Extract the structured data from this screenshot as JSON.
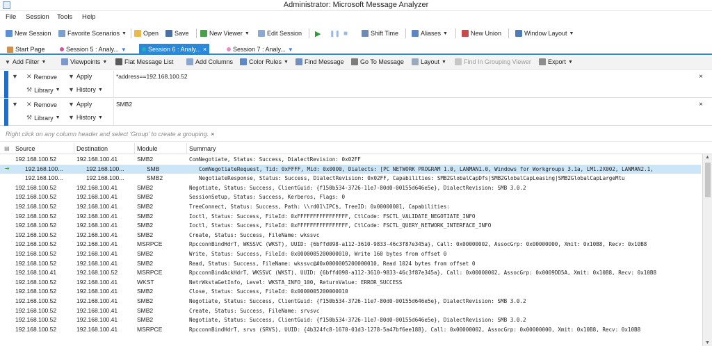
{
  "window": {
    "title": "Administrator: Microsoft Message Analyzer"
  },
  "menu": [
    "File",
    "Session",
    "Tools",
    "Help"
  ],
  "toolbar": {
    "new_session": "New Session",
    "favorite_scenarios": "Favorite Scenarios",
    "open": "Open",
    "save": "Save",
    "new_viewer": "New Viewer",
    "edit_session": "Edit Session",
    "shift_time": "Shift Time",
    "aliases": "Aliases",
    "new_union": "New Union",
    "window_layout": "Window Layout"
  },
  "tabs": [
    {
      "label": "Start Page"
    },
    {
      "label": "Session 5 : Analy..."
    },
    {
      "label": "Session 6 : Analy...",
      "close": "×"
    },
    {
      "label": "Session 7 : Analy..."
    }
  ],
  "viewbar": {
    "add_filter": "Add Filter",
    "viewpoints": "Viewpoints",
    "flat_message_list": "Flat Message List",
    "add_columns": "Add Columns",
    "color_rules": "Color Rules",
    "find_message": "Find Message",
    "go_to_message": "Go To Message",
    "layout": "Layout",
    "find_in_grouping": "Find In Grouping Viewer",
    "export": "Export"
  },
  "filters": [
    {
      "remove": "Remove",
      "apply": "Apply",
      "library": "Library",
      "history": "History",
      "expression": "*address==192.168.100.52",
      "close": "×"
    },
    {
      "remove": "Remove",
      "apply": "Apply",
      "library": "Library",
      "history": "History",
      "expression": "SMB2",
      "close": "×"
    }
  ],
  "grouping_hint": "Right click on any column header and select 'Group' to create a grouping.",
  "grouping_close": "×",
  "columns": {
    "source": "Source",
    "destination": "Destination",
    "module": "Module",
    "summary": "Summary"
  },
  "rows": [
    {
      "source": "192.168.100.52",
      "destination": "192.168.100.41",
      "module": "SMB2",
      "summary": "ComNegotiate, Status: Success, DialectRevision: 0x02FF"
    },
    {
      "source": "192.168.100...",
      "destination": "192.168.100...",
      "module": "SMB",
      "summary": "ComNegotiateRequest, Tid: 0xFFFF, Mid: 0x0000, Dialects: [PC NETWORK PROGRAM 1.0, LANMAN1.0, Windows for Workgroups 3.1a, LM1.2X002, LANMAN2.1,",
      "child": true,
      "selected": true
    },
    {
      "source": "192.168.100...",
      "destination": "192.168.100...",
      "module": "SMB2",
      "summary": "NegotiateResponse, Status: Success, DialectRevision: 0x02FF, Capabilities: SMB2GlobalCapDfs|SMB2GlobalCapLeasing|SMB2GlobalCapLargeMtu",
      "child": true
    },
    {
      "source": "192.168.100.52",
      "destination": "192.168.100.41",
      "module": "SMB2",
      "summary": "Negotiate, Status: Success, ClientGuid: {f150b534-3726-11e7-80d0-00155d646e5e}, DialectRevision: SMB 3.0.2"
    },
    {
      "source": "192.168.100.52",
      "destination": "192.168.100.41",
      "module": "SMB2",
      "summary": "SessionSetup, Status: Success, Kerberos, Flags: 0"
    },
    {
      "source": "192.168.100.52",
      "destination": "192.168.100.41",
      "module": "SMB2",
      "summary": "TreeConnect, Status: Success, Path: \\\\rd01\\IPC$, TreeID: 0x00000001, Capabilities:"
    },
    {
      "source": "192.168.100.52",
      "destination": "192.168.100.41",
      "module": "SMB2",
      "summary": "Ioctl, Status: Success, FileId: 0xFFFFFFFFFFFFFFFF, CtlCode: FSCTL_VALIDATE_NEGOTIATE_INFO"
    },
    {
      "source": "192.168.100.52",
      "destination": "192.168.100.41",
      "module": "SMB2",
      "summary": "Ioctl, Status: Success, FileId: 0xFFFFFFFFFFFFFFFF, CtlCode: FSCTL_QUERY_NETWORK_INTERFACE_INFO"
    },
    {
      "source": "192.168.100.52",
      "destination": "192.168.100.41",
      "module": "SMB2",
      "summary": "Create, Status: Success, FileName: wkssvc"
    },
    {
      "source": "192.168.100.52",
      "destination": "192.168.100.41",
      "module": "MSRPCE",
      "summary": "RpcconnBindHdrT, WKSSVC (WKST), UUID: {6bffd098-a112-3610-9833-46c3f87e345a}, Call: 0x00000002, AssocGrp: 0x00000000, Xmit: 0x10B8, Recv: 0x10B8"
    },
    {
      "source": "192.168.100.52",
      "destination": "192.168.100.41",
      "module": "SMB2",
      "summary": "Write, Status: Success, FileId: 0x0000005200000010, Write 160 bytes from offset 0"
    },
    {
      "source": "192.168.100.52",
      "destination": "192.168.100.41",
      "module": "SMB2",
      "summary": "Read, Status: Success, FileName: wkssvc@#0x0000005200000010, Read 1024 bytes from offset 0"
    },
    {
      "source": "192.168.100.41",
      "destination": "192.168.100.52",
      "module": "MSRPCE",
      "summary": "RpcconnBindAckHdrT, WKSSVC (WKST), UUID: {6bffd098-a112-3610-9833-46c3f87e345a}, Call: 0x00000002, AssocGrp: 0x0009DD5A, Xmit: 0x10B8, Recv: 0x10B8"
    },
    {
      "source": "192.168.100.52",
      "destination": "192.168.100.41",
      "module": "WKST",
      "summary": "NetrWkstaGetInfo, Level: WKSTA_INFO_100, ReturnValue: ERROR_SUCCESS"
    },
    {
      "source": "192.168.100.52",
      "destination": "192.168.100.41",
      "module": "SMB2",
      "summary": "Close, Status: Success, FileId: 0x0000005200000010"
    },
    {
      "source": "192.168.100.52",
      "destination": "192.168.100.41",
      "module": "SMB2",
      "summary": "Negotiate, Status: Success, ClientGuid: {f150b534-3726-11e7-80d0-00155d646e5e}, DialectRevision: SMB 3.0.2"
    },
    {
      "source": "192.168.100.52",
      "destination": "192.168.100.41",
      "module": "SMB2",
      "summary": "Create, Status: Success, FileName: srvsvc"
    },
    {
      "source": "192.168.100.52",
      "destination": "192.168.100.41",
      "module": "SMB2",
      "summary": "Negotiate, Status: Success, ClientGuid: {f150b534-3726-11e7-80d0-00155d646e5e}, DialectRevision: SMB 3.0.2"
    },
    {
      "source": "192.168.100.52",
      "destination": "192.168.100.41",
      "module": "MSRPCE",
      "summary": "RpcconnBindHdrT, srvs (SRVS), UUID: {4b324fc8-1670-01d3-1278-5a47bf6ee188}, Call: 0x00000002, AssocGrp: 0x00000000, Xmit: 0x10B8, Recv: 0x10B8"
    }
  ]
}
